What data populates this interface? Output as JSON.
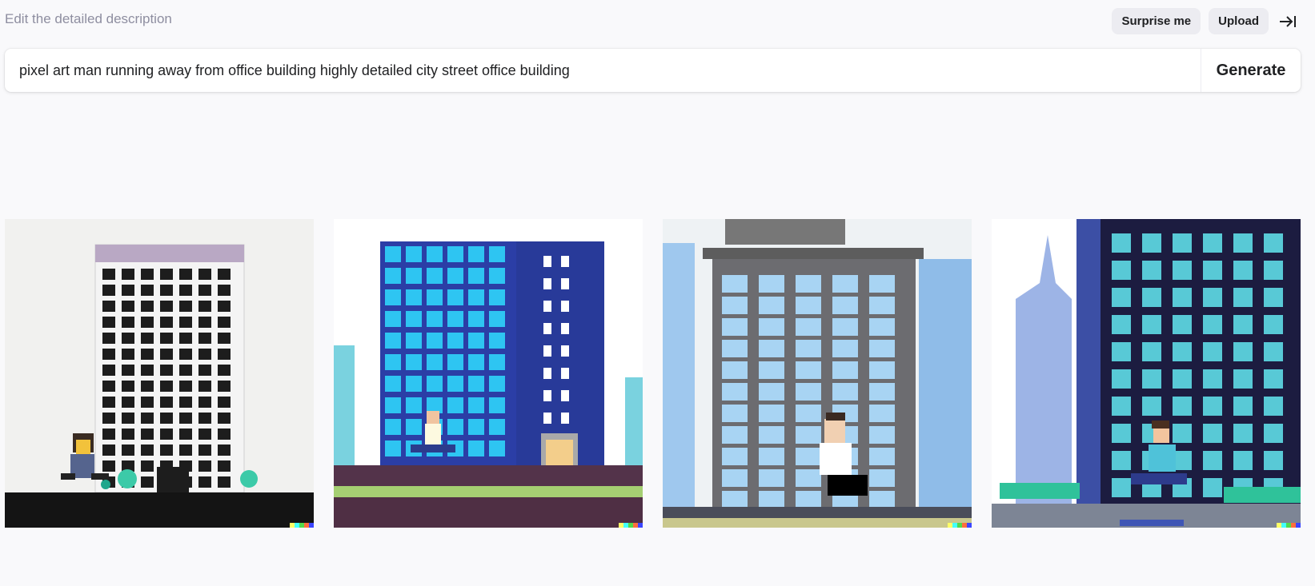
{
  "header": {
    "hint": "Edit the detailed description",
    "surprise_label": "Surprise me",
    "upload_label": "Upload",
    "collapse_icon": "collapse-right-icon"
  },
  "prompt": {
    "value": "pixel art man running away from office building highly detailed city street office building",
    "generate_label": "Generate"
  },
  "results": [
    {
      "name": "result-image-1"
    },
    {
      "name": "result-image-2"
    },
    {
      "name": "result-image-3"
    },
    {
      "name": "result-image-4"
    }
  ],
  "watermark_colors": [
    "#ffff66",
    "#42ffff",
    "#51da4c",
    "#ff6e3c",
    "#3c46ff"
  ]
}
